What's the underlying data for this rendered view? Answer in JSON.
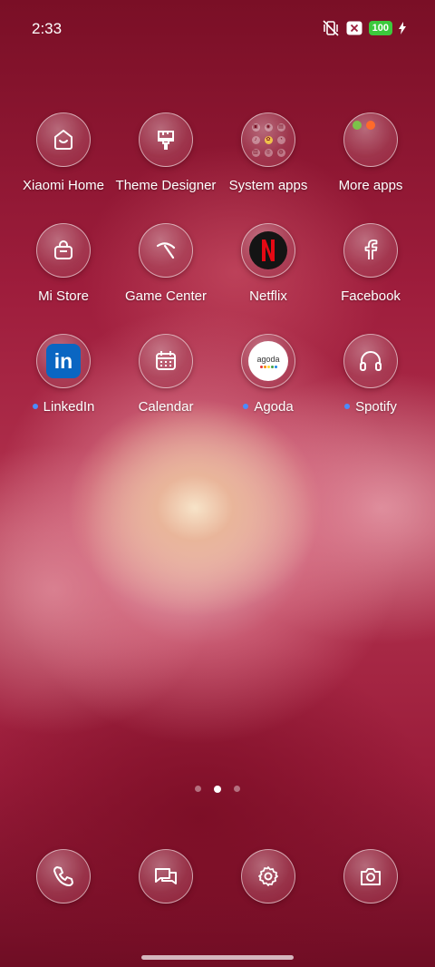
{
  "status_bar": {
    "time": "2:33",
    "battery": "100",
    "icons": [
      "vibrate-off-icon",
      "close-box-icon",
      "battery-icon",
      "charging-bolt-icon"
    ]
  },
  "apps": [
    {
      "name": "xiaomi-home",
      "label": "Xiaomi Home",
      "icon": "home-icon",
      "dot": false
    },
    {
      "name": "theme-designer",
      "label": "Theme Designer",
      "icon": "brush-icon",
      "dot": false
    },
    {
      "name": "system-apps",
      "label": "System apps",
      "icon": "folder-icon",
      "dot": false
    },
    {
      "name": "more-apps",
      "label": "More apps",
      "icon": "folder-icon",
      "dot": false
    },
    {
      "name": "mi-store",
      "label": "Mi Store",
      "icon": "shopping-bag-icon",
      "dot": false
    },
    {
      "name": "game-center",
      "label": "Game Center",
      "icon": "pickaxe-icon",
      "dot": false
    },
    {
      "name": "netflix",
      "label": "Netflix",
      "icon": "netflix-icon",
      "dot": false
    },
    {
      "name": "facebook",
      "label": "Facebook",
      "icon": "facebook-icon",
      "dot": false
    },
    {
      "name": "linkedin",
      "label": "LinkedIn",
      "icon": "linkedin-icon",
      "dot": true
    },
    {
      "name": "calendar",
      "label": "Calendar",
      "icon": "calendar-icon",
      "dot": false
    },
    {
      "name": "agoda",
      "label": "Agoda",
      "icon": "agoda-icon",
      "dot": true,
      "logo_text": "agoda"
    },
    {
      "name": "spotify",
      "label": "Spotify",
      "icon": "headphones-icon",
      "dot": true
    }
  ],
  "pages": {
    "count": 3,
    "active": 2
  },
  "dock": [
    {
      "name": "phone",
      "icon": "phone-icon"
    },
    {
      "name": "messages",
      "icon": "chat-icon"
    },
    {
      "name": "settings",
      "icon": "gear-icon"
    },
    {
      "name": "camera",
      "icon": "camera-icon"
    }
  ],
  "colors": {
    "accent_dot": "#4a8cff",
    "battery": "#3cc93c",
    "netflix": "#e50914",
    "linkedin": "#0a66c2"
  }
}
